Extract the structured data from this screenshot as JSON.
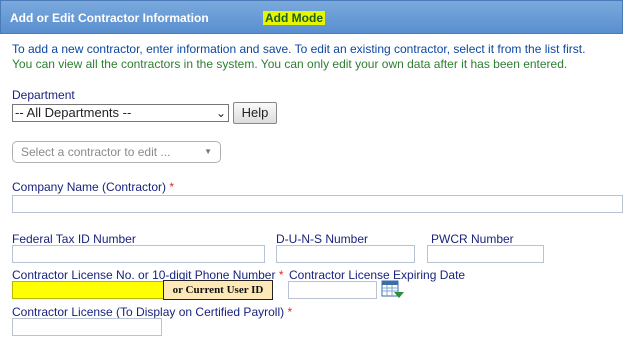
{
  "header": {
    "title": "Add or Edit Contractor Information",
    "mode": "Add Mode"
  },
  "instructions": {
    "line1": "To add a new contractor, enter information and save. To edit an existing contractor, select it from the list first.",
    "line2": "You can view all the contractors in the system. You can only edit your own data after it has been entered."
  },
  "department": {
    "label": "Department",
    "selected": "-- All Departments --",
    "help_label": "Help"
  },
  "contractor_select": {
    "placeholder": "Select a contractor to edit ..."
  },
  "fields": {
    "company_name": {
      "label": "Company Name (Contractor)",
      "required": "*",
      "value": ""
    },
    "federal_tax_id": {
      "label": "Federal Tax ID Number",
      "value": ""
    },
    "duns": {
      "label": "D-U-N-S Number",
      "value": ""
    },
    "pwcr": {
      "label": "PWCR Number",
      "value": ""
    },
    "license_no": {
      "label": "Contractor License No. or 10-digit Phone Number",
      "required": "*",
      "value": ""
    },
    "license_expiry": {
      "label": "Contractor License Expiring Date",
      "value": ""
    },
    "license_display": {
      "label": "Contractor License (To Display on Certified Payroll)",
      "required": "*",
      "value": ""
    }
  },
  "tooltip": {
    "text": "or Current User ID"
  },
  "colors": {
    "header_bg": "#6a9cd6",
    "mode_badge_bg": "#e6f500",
    "label_text": "#1a237e",
    "required_mark": "#d32f2f",
    "highlight_field": "#ffff00"
  },
  "icons": {
    "calendar": "calendar-icon",
    "dropdown": "chevron-down-icon"
  }
}
